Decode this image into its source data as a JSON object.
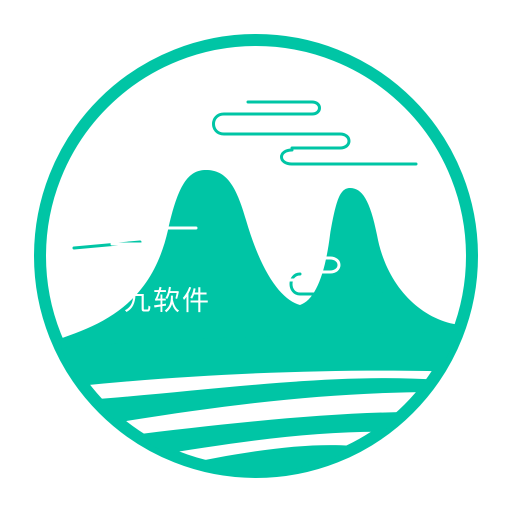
{
  "logo": {
    "brand_text": "九软件",
    "colors": {
      "primary": "#00C5A5",
      "background": "#FFFFFF"
    },
    "icon_name": "mountain-waves-circle-logo"
  }
}
